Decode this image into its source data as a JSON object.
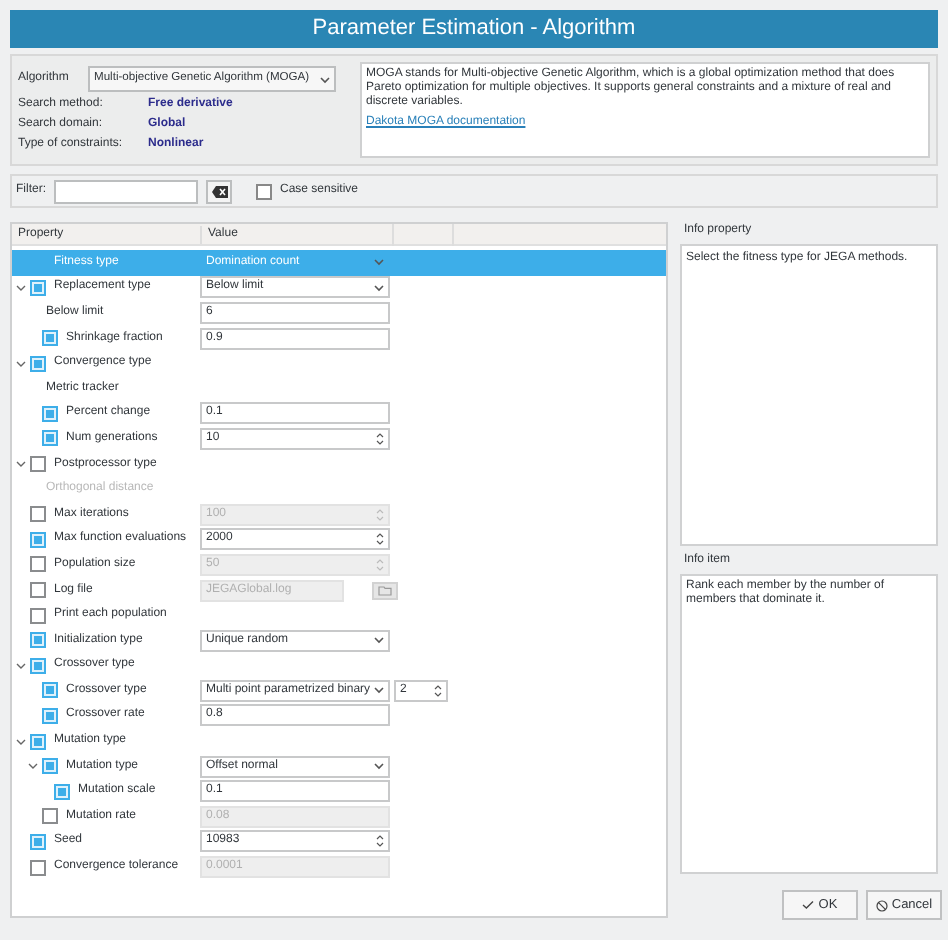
{
  "window": {
    "title": "Parameter Estimation - Algorithm"
  },
  "algorithm": {
    "label": "Algorithm",
    "value": "Multi-objective Genetic Algorithm (MOGA)",
    "properties": [
      {
        "label": "Search method:",
        "value": "Free derivative"
      },
      {
        "label": "Search domain:",
        "value": "Global"
      },
      {
        "label": "Type of constraints:",
        "value": "Nonlinear"
      }
    ],
    "description": "MOGA stands for Multi-objective Genetic Algorithm, which is a global optimization method that does Pareto optimization for multiple objectives. It supports general constraints and a mixture of real and discrete variables.",
    "link": "Dakota MOGA documentation"
  },
  "filter": {
    "label": "Filter:",
    "case_sensitive": {
      "label": "Case sensitive",
      "checked": false
    }
  },
  "table": {
    "columns": [
      "Property",
      "Value"
    ],
    "rows": [
      {
        "label": "Fitness type",
        "selected": true,
        "value": {
          "kind": "combo",
          "text": "Domination count"
        }
      },
      {
        "label": "Replacement type",
        "checked": true,
        "expanded": true,
        "selected": false,
        "value": {
          "kind": "combo",
          "text": "Below limit"
        },
        "children": [
          {
            "label": "Below limit",
            "selected": false,
            "value": {
              "kind": "text",
              "text": "6"
            }
          },
          {
            "label": "Shrinkage fraction",
            "checked": true,
            "selected": false,
            "value": {
              "kind": "text",
              "text": "0.9"
            }
          }
        ]
      },
      {
        "label": "Convergence type",
        "checked": true,
        "expanded": true,
        "selected": false,
        "children": [
          {
            "label": "Metric tracker",
            "selected": false
          },
          {
            "label": "Percent change",
            "checked": true,
            "selected": false,
            "value": {
              "kind": "text",
              "text": "0.1"
            }
          },
          {
            "label": "Num generations",
            "checked": true,
            "selected": false,
            "value": {
              "kind": "spin",
              "text": "10"
            }
          }
        ]
      },
      {
        "label": "Postprocessor type",
        "checked": false,
        "expanded": true,
        "selected": false,
        "children": [
          {
            "label": "Orthogonal distance",
            "selected": false,
            "disabled": true
          }
        ]
      },
      {
        "label": "Max iterations",
        "checked": false,
        "selected": false,
        "value": {
          "kind": "spin",
          "text": "100",
          "disabled": true
        }
      },
      {
        "label": "Max function evaluations",
        "checked": true,
        "selected": false,
        "value": {
          "kind": "spin",
          "text": "2000"
        }
      },
      {
        "label": "Population size",
        "checked": false,
        "selected": false,
        "value": {
          "kind": "spin",
          "text": "50",
          "disabled": true
        }
      },
      {
        "label": "Log file",
        "checked": false,
        "selected": false,
        "value": {
          "kind": "file",
          "text": "JEGAGlobal.log",
          "disabled": true
        }
      },
      {
        "label": "Print each population",
        "checked": false,
        "selected": false
      },
      {
        "label": "Initialization type",
        "checked": true,
        "selected": false,
        "value": {
          "kind": "combo",
          "text": "Unique random"
        }
      },
      {
        "label": "Crossover type",
        "checked": true,
        "expanded": true,
        "selected": false,
        "children": [
          {
            "label": "Crossover type",
            "checked": true,
            "selected": false,
            "value": {
              "kind": "combo",
              "text": "Multi point parametrized binary",
              "extra": "2"
            }
          },
          {
            "label": "Crossover rate",
            "checked": true,
            "selected": false,
            "value": {
              "kind": "text",
              "text": "0.8"
            }
          }
        ]
      },
      {
        "label": "Mutation type",
        "checked": true,
        "expanded": true,
        "selected": false,
        "children": [
          {
            "label": "Mutation type",
            "checked": true,
            "expanded": true,
            "selected": false,
            "value": {
              "kind": "combo",
              "text": "Offset normal"
            },
            "children": [
              {
                "label": "Mutation scale",
                "checked": true,
                "selected": false,
                "value": {
                  "kind": "text",
                  "text": "0.1"
                }
              }
            ]
          },
          {
            "label": "Mutation rate",
            "checked": false,
            "selected": false,
            "value": {
              "kind": "text",
              "text": "0.08",
              "disabled": true
            }
          }
        ]
      },
      {
        "label": "Seed",
        "checked": true,
        "selected": false,
        "value": {
          "kind": "spin",
          "text": "10983"
        }
      },
      {
        "label": "Convergence tolerance",
        "checked": false,
        "selected": false,
        "value": {
          "kind": "text",
          "text": "0.0001",
          "disabled": true
        }
      }
    ]
  },
  "info_property": {
    "label": "Info property",
    "text": "Select the fitness type for JEGA methods."
  },
  "info_item": {
    "label": "Info item",
    "text": "Rank each member by the number of members that dominate it."
  },
  "buttons": [
    {
      "kind": "ok",
      "label": "OK"
    },
    {
      "kind": "cancel",
      "label": "Cancel"
    }
  ]
}
